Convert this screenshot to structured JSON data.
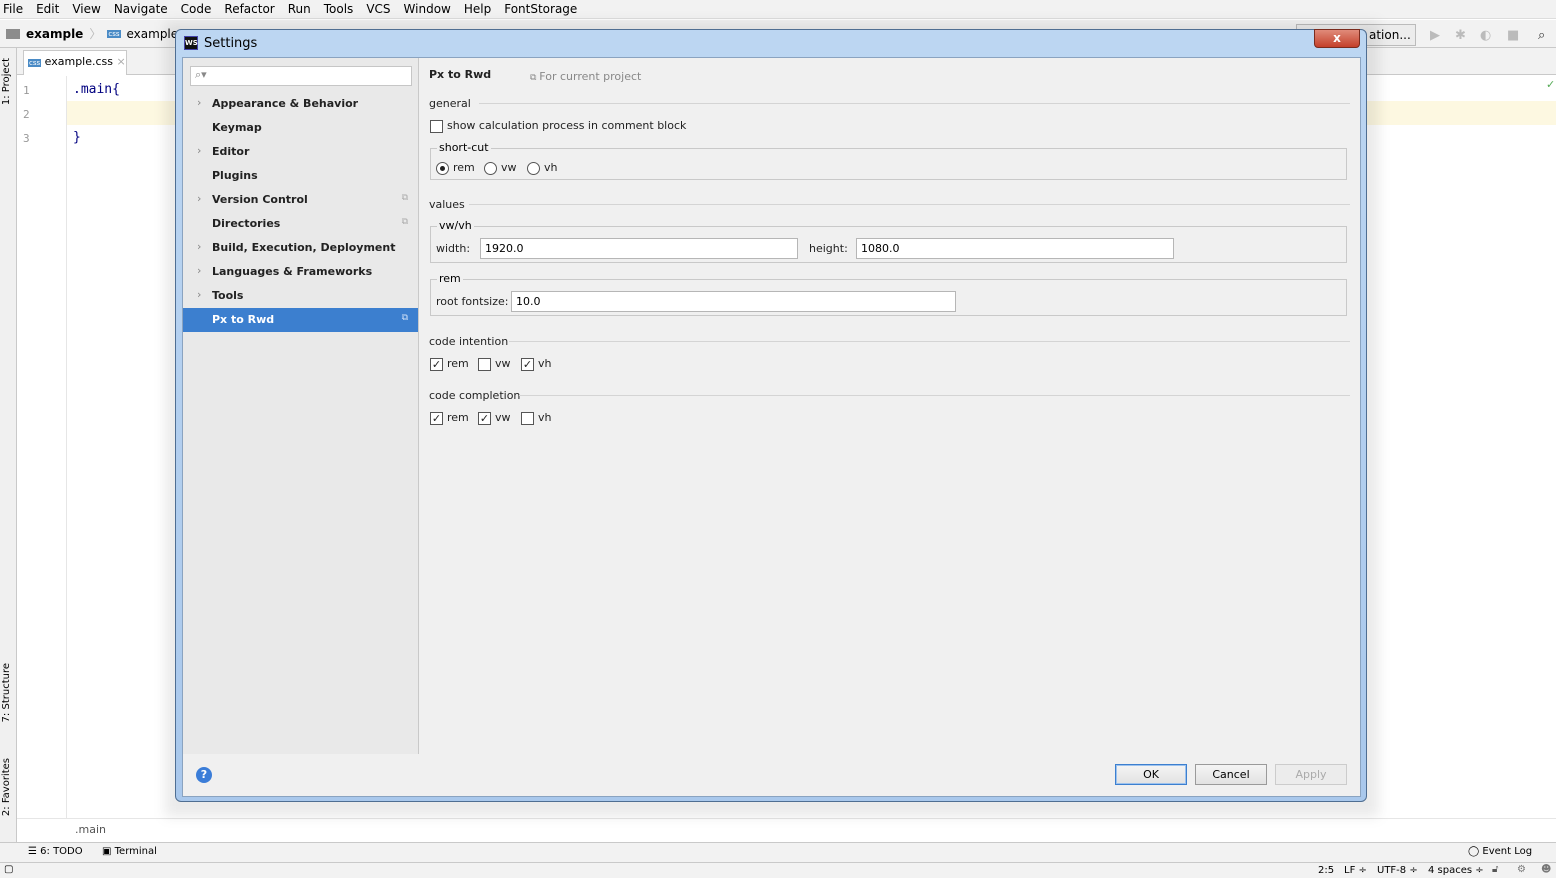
{
  "menubar": [
    "File",
    "Edit",
    "View",
    "Navigate",
    "Code",
    "Refactor",
    "Run",
    "Tools",
    "VCS",
    "Window",
    "Help",
    "FontStorage"
  ],
  "navbar": {
    "project": "example",
    "file": "example.css",
    "run_config": "ation..."
  },
  "side_strip": {
    "project": "1: Project",
    "structure": "7: Structure",
    "favorites": "2: Favorites"
  },
  "editor": {
    "tab": "example.css",
    "lines": [
      "1",
      "2",
      "3"
    ],
    "code": [
      ".main{",
      "",
      "}"
    ],
    "breadcrumb": ".main"
  },
  "bottom_tools": {
    "todo": "6: TODO",
    "terminal": "Terminal",
    "event_log": "Event Log"
  },
  "status": {
    "position": "2:5",
    "line_sep": "LF ÷",
    "encoding": "UTF-8 ÷",
    "indent": "4 spaces ÷"
  },
  "dialog": {
    "title": "Settings",
    "close": "x",
    "search_placeholder": "",
    "sidebar": [
      {
        "label": "Appearance & Behavior",
        "expandable": true
      },
      {
        "label": "Keymap"
      },
      {
        "label": "Editor",
        "expandable": true
      },
      {
        "label": "Plugins"
      },
      {
        "label": "Version Control",
        "expandable": true,
        "project": true
      },
      {
        "label": "Directories",
        "project": true
      },
      {
        "label": "Build, Execution, Deployment",
        "expandable": true
      },
      {
        "label": "Languages & Frameworks",
        "expandable": true
      },
      {
        "label": "Tools",
        "expandable": true
      },
      {
        "label": "Px to Rwd",
        "project": true,
        "selected": true
      }
    ],
    "page_title": "Px to Rwd",
    "scope": "For current project",
    "general": {
      "label": "general",
      "show_calc": "show calculation process in comment block",
      "show_calc_checked": false
    },
    "shortcut": {
      "label": "short-cut",
      "options": [
        "rem",
        "vw",
        "vh"
      ],
      "selected": "rem"
    },
    "values": {
      "label": "values",
      "vwvh_label": "vw/vh",
      "width_label": "width:",
      "width": "1920.0",
      "height_label": "height:",
      "height": "1080.0",
      "rem_label": "rem",
      "root_label": "root fontsize:",
      "root": "10.0"
    },
    "code_intention": {
      "label": "code intention",
      "items": [
        {
          "label": "rem",
          "checked": true
        },
        {
          "label": "vw",
          "checked": false
        },
        {
          "label": "vh",
          "checked": true
        }
      ]
    },
    "code_completion": {
      "label": "code completion",
      "items": [
        {
          "label": "rem",
          "checked": true
        },
        {
          "label": "vw",
          "checked": true
        },
        {
          "label": "vh",
          "checked": false
        }
      ]
    },
    "buttons": {
      "ok": "OK",
      "cancel": "Cancel",
      "apply": "Apply"
    },
    "help": "?"
  }
}
